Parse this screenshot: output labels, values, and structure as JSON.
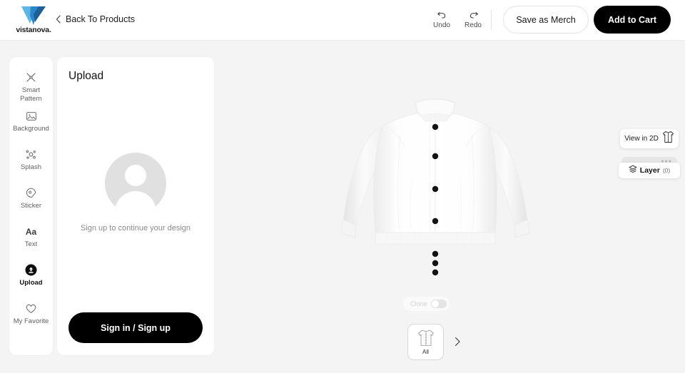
{
  "header": {
    "logo_name": "vistanova.",
    "logo_icon": "v-logo-icon",
    "logo_colors": {
      "light": "#5bb6e6",
      "mid": "#2b87c8",
      "dark": "#1f5f96"
    },
    "back_label": "Back To Products",
    "back_icon": "chevron-left-icon",
    "undo": {
      "label": "Undo",
      "icon": "undo-arrow-icon"
    },
    "redo": {
      "label": "Redo",
      "icon": "redo-arrow-icon"
    },
    "save_as_merch_label": "Save as Merch",
    "add_to_cart_label": "Add to Cart"
  },
  "sidebar": {
    "items": [
      {
        "label": "Smart\nPattern",
        "label_line1": "Smart",
        "label_line2": "Pattern",
        "icon": "smart-pattern-icon",
        "active": false
      },
      {
        "label": "Background",
        "icon": "background-image-icon",
        "active": false
      },
      {
        "label": "Splash",
        "icon": "splash-icon",
        "active": false
      },
      {
        "label": "Sticker",
        "icon": "sticker-tag-icon",
        "active": false
      },
      {
        "label": "Text",
        "icon": "text-aa-icon",
        "glyph": "Aa",
        "active": false
      },
      {
        "label": "Upload",
        "icon": "upload-circle-icon",
        "active": true
      },
      {
        "label": "My Favorite",
        "icon": "heart-icon",
        "active": false
      }
    ]
  },
  "panel": {
    "title": "Upload",
    "avatar_icon": "user-avatar-placeholder",
    "hint": "Sign up to continue your design",
    "signin_label": "Sign in / Sign up"
  },
  "canvas": {
    "product": "white-bomber-jacket",
    "product_color": "#ffffff",
    "button_color": "#111111",
    "background": "#f4f4f5"
  },
  "right_controls": {
    "view_toggle_label": "View in 2D",
    "view_toggle_icon": "garment-outline-icon",
    "layer_label": "Layer",
    "layer_count": "(0)",
    "layer_icon": "layers-stack-icon"
  },
  "clone_toggle": {
    "label": "Clone",
    "enabled": false,
    "icon": "toggle-switch-off-icon"
  },
  "thumbnails": {
    "items": [
      {
        "label": "All",
        "icon": "jacket-thumb-icon",
        "selected": true
      }
    ],
    "next_icon": "chevron-right-icon"
  }
}
